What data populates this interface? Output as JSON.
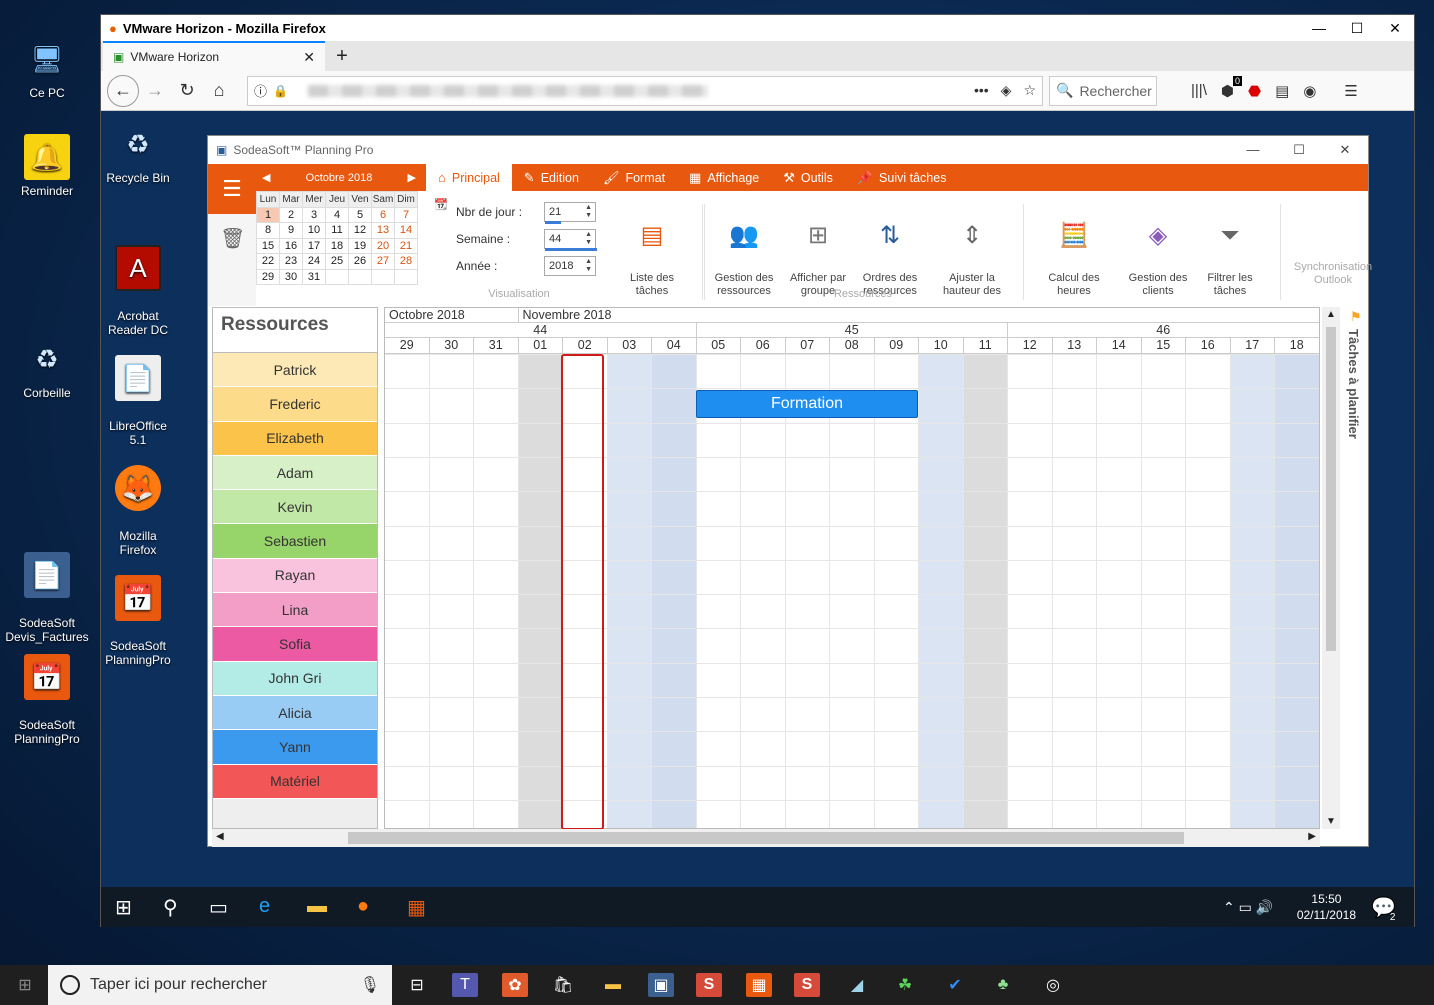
{
  "desktop": {
    "host_icons": [
      {
        "label": "Ce PC",
        "glyph": "🖥"
      },
      {
        "label": "Reminder",
        "glyph": "🔔"
      },
      {
        "label": "Corbeille",
        "glyph": "♻"
      },
      {
        "label": "SodeaSoft\nDevis_Factures",
        "glyph": "📄"
      },
      {
        "label": "SodeaSoft\nPlanningPro",
        "glyph": "📅"
      }
    ],
    "vm_icons": [
      {
        "label": "Recycle Bin",
        "glyph": "♻"
      },
      {
        "label": "Acrobat\nReader DC",
        "glyph": "A"
      },
      {
        "label": "LibreOffice\n5.1",
        "glyph": "📄"
      },
      {
        "label": "Mozilla\nFirefox",
        "glyph": "🦊"
      },
      {
        "label": "SodeaSoft\nPlanningPro",
        "glyph": "📅"
      }
    ]
  },
  "firefox": {
    "window_title": "VMware Horizon - Mozilla Firefox",
    "tab_label": "VMware Horizon",
    "search_placeholder": "Rechercher",
    "badge": "0"
  },
  "app": {
    "title": "SodeaSoft™ Planning Pro",
    "tabs": [
      {
        "label": "Principal",
        "icon": "home-icon",
        "glyph": "⌂"
      },
      {
        "label": "Edition",
        "icon": "edit-icon",
        "glyph": "✎"
      },
      {
        "label": "Format",
        "icon": "paint-icon",
        "glyph": "🖌"
      },
      {
        "label": "Affichage",
        "icon": "grid-icon",
        "glyph": "▦"
      },
      {
        "label": "Outils",
        "icon": "tools-icon",
        "glyph": "⚒"
      },
      {
        "label": "Suivi tâches",
        "icon": "pin-icon",
        "glyph": "📌"
      }
    ],
    "mini_calendar": {
      "month": "Octobre 2018",
      "dow": [
        "Lun",
        "Mar",
        "Mer",
        "Jeu",
        "Ven",
        "Sam",
        "Dim"
      ],
      "weeks": [
        [
          "1",
          "2",
          "3",
          "4",
          "5",
          "6",
          "7"
        ],
        [
          "8",
          "9",
          "10",
          "11",
          "12",
          "13",
          "14"
        ],
        [
          "15",
          "16",
          "17",
          "18",
          "19",
          "20",
          "21"
        ],
        [
          "22",
          "23",
          "24",
          "25",
          "26",
          "27",
          "28"
        ],
        [
          "29",
          "30",
          "31",
          "",
          "",
          "",
          ""
        ]
      ]
    },
    "visualisation": {
      "nbr_jour_label": "Nbr de jour :",
      "nbr_jour": "21",
      "semaine_label": "Semaine :",
      "semaine": "44",
      "annee_label": "Année :",
      "annee": "2018",
      "group_label": "Visualisation"
    },
    "buttons": {
      "liste_taches": "Liste des\ntâches",
      "gestion_ressources": "Gestion des\nressources",
      "afficher_groupe": "Afficher par\ngroupe",
      "ordres_ressources": "Ordres des\nressources",
      "ajuster_hauteur": "Ajuster la\nhauteur des",
      "ressources_group": "Ressources",
      "calcul_heures": "Calcul des\nheures",
      "gestion_clients": "Gestion des\nclients",
      "filtrer_taches": "Filtrer les\ntâches",
      "sync_outlook": "Synchronisation\nOutlook"
    },
    "resources_title": "Ressources",
    "resources": [
      {
        "name": "Patrick",
        "color": "#fde9b5"
      },
      {
        "name": "Frederic",
        "color": "#fcdb8a"
      },
      {
        "name": "Elizabeth",
        "color": "#fbc34a"
      },
      {
        "name": "Adam",
        "color": "#d7f0c7"
      },
      {
        "name": "Kevin",
        "color": "#c1e8a7"
      },
      {
        "name": "Sebastien",
        "color": "#97d46a"
      },
      {
        "name": "Rayan",
        "color": "#f9c3dd"
      },
      {
        "name": "Lina",
        "color": "#f29ec6"
      },
      {
        "name": "Sofia",
        "color": "#eb5aa3"
      },
      {
        "name": "John Gri",
        "color": "#b3ece6"
      },
      {
        "name": "Alicia",
        "color": "#98ccf5"
      },
      {
        "name": "Yann",
        "color": "#3b99ee"
      },
      {
        "name": "Matériel",
        "color": "#f25656"
      }
    ],
    "months": [
      "Octobre 2018",
      "Novembre 2018"
    ],
    "weeks": [
      "44",
      "45",
      "46"
    ],
    "days": [
      "29",
      "30",
      "31",
      "01",
      "02",
      "03",
      "04",
      "05",
      "06",
      "07",
      "08",
      "09",
      "10",
      "11",
      "12",
      "13",
      "14",
      "15",
      "16",
      "17",
      "18"
    ],
    "event": {
      "label": "Formation"
    },
    "side_panel": "Tâches à planifier"
  },
  "vm_taskbar": {
    "time": "15:50",
    "date": "02/11/2018",
    "notifications": "2"
  },
  "host_taskbar": {
    "search_placeholder": "Taper ici pour rechercher"
  }
}
